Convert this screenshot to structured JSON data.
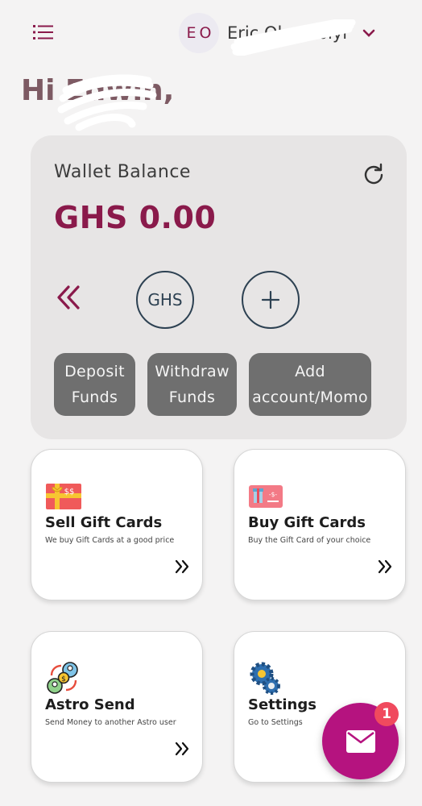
{
  "header": {
    "avatar_initials": "EO",
    "user_name": "Eric Oluwabiyi",
    "greeting": "Hi Edwin,"
  },
  "wallet": {
    "title": "Wallet Balance",
    "balance": "GHS 0.00",
    "currency_label": "GHS",
    "add_label": "+",
    "deposit_label_1": "Deposit",
    "deposit_label_2": "Funds",
    "withdraw_label_1": "Withdraw",
    "withdraw_label_2": "Funds",
    "add_account_label_1": "Add",
    "add_account_label_2": "account/Momo"
  },
  "features": {
    "sell": {
      "title": "Sell Gift Cards",
      "desc": "We buy Gift Cards at a good price",
      "icon": "gift-card-dollar-icon"
    },
    "buy": {
      "title": "Buy Gift Cards",
      "desc": "Buy the Gift Card of your choice",
      "icon": "gift-card-icon"
    },
    "send": {
      "title": "Astro Send",
      "desc": "Send Money to another Astro user",
      "icon": "money-transfer-icon"
    },
    "settings": {
      "title": "Settings",
      "desc": "Go to Settings",
      "icon": "gears-icon"
    }
  },
  "fab": {
    "badge_count": "1",
    "icon": "mail-icon"
  },
  "colors": {
    "brand": "#8a1a4b",
    "fab": "#b5137f",
    "badge": "#f04a5e",
    "button": "#6f6f6f"
  }
}
